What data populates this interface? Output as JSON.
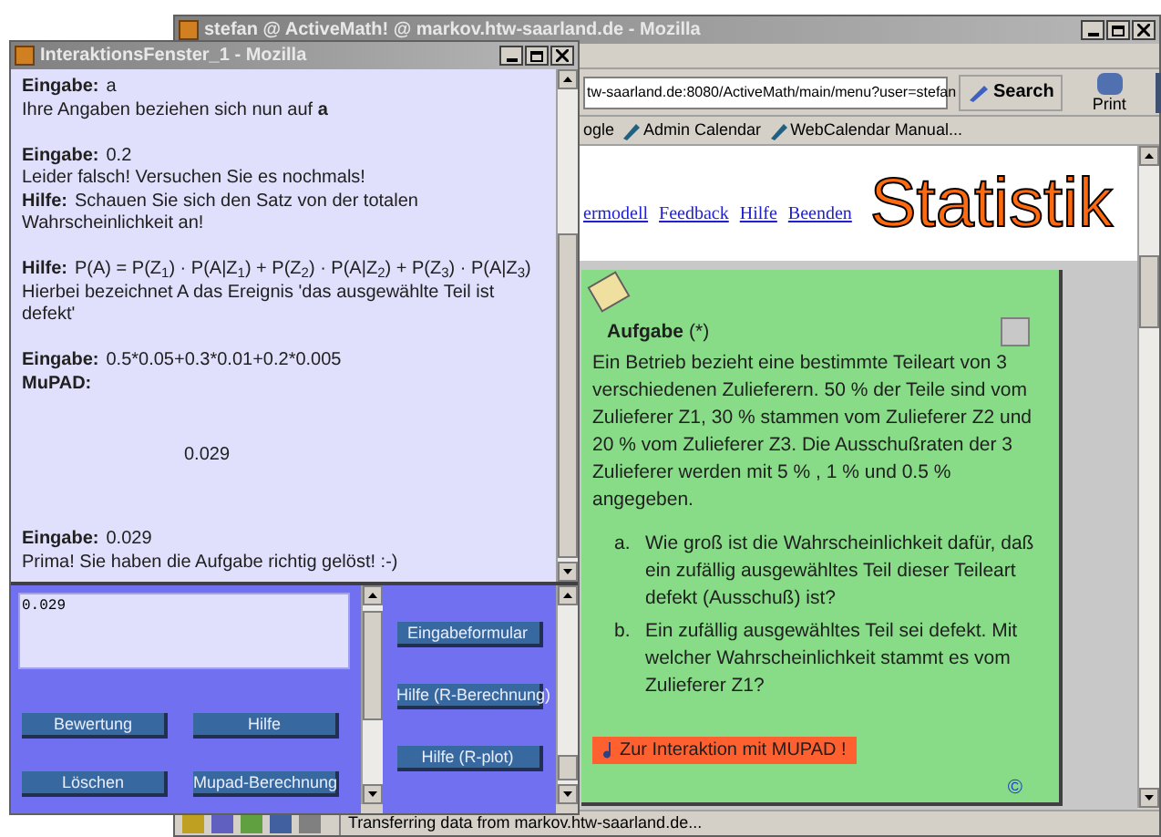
{
  "main_window": {
    "title": "stefan @ ActiveMath! @ markov.htw-saarland.de - Mozilla",
    "url": "tw-saarland.de:8080/ActiveMath/main/menu?user=stefan",
    "search_button": "Search",
    "print_button": "Print",
    "bookmarks": [
      "ogle",
      "Admin Calendar",
      "WebCalendar Manual..."
    ],
    "nav_links": [
      "ermodell",
      "Feedback",
      "Hilfe",
      "Beenden"
    ],
    "logo": "Statistik",
    "exercise": {
      "title": "Aufgabe",
      "stars": "(*)",
      "text": "Ein Betrieb bezieht eine bestimmte Teileart von 3 verschiedenen Zulieferern. 50 % der Teile sind vom Zulieferer Z1, 30 % stammen vom Zulieferer Z2 und 20 % vom Zulieferer Z3. Die Ausschußraten der 3 Zulieferer werden mit 5 % , 1 % und 0.5 % angegeben.",
      "questions": [
        {
          "marker": "a.",
          "text": "Wie groß ist die Wahrscheinlichkeit dafür, daß ein zufällig ausgewähltes Teil dieser Teileart defekt (Ausschuß) ist?"
        },
        {
          "marker": "b.",
          "text": "Ein zufällig ausgewähltes Teil sei defekt. Mit welcher Wahrscheinlichkeit stammt es vom Zulieferer Z1?"
        }
      ],
      "action_button": "Zur Interaktion mit MUPAD !",
      "copyright": "©"
    },
    "status": "Transferring data from markov.htw-saarland.de..."
  },
  "popup": {
    "title": "InteraktionsFenster_1 - Mozilla",
    "log": [
      {
        "kind": "text",
        "lines": [
          {
            "label": "Eingabe:",
            "text": "a"
          },
          {
            "text": "Ihre Angaben beziehen sich nun auf **a**"
          }
        ]
      },
      {
        "kind": "text",
        "lines": [
          {
            "label": "Eingabe:",
            "text": "0.2"
          },
          {
            "text": "Leider falsch! Versuchen Sie es nochmals!"
          },
          {
            "label": "Hilfe:",
            "text": "Schauen Sie sich den Satz von der totalen Wahrscheinlichkeit an!"
          }
        ]
      },
      {
        "kind": "text",
        "lines": [
          {
            "label": "Hilfe:",
            "text": "P(A) = P(Z$_{1}$) · P(A|Z$_{1}$) + P(Z$_{2}$) · P(A|Z$_{2}$) + P(Z$_{3}$) · P(A|Z$_{3}$)"
          },
          {
            "text": "Hierbei bezeichnet A das Ereignis 'das ausgewählte Teil ist defekt'"
          }
        ]
      },
      {
        "kind": "text",
        "lines": [
          {
            "label": "Eingabe:",
            "text": "0.5*0.05+0.3*0.01+0.2*0.005"
          },
          {
            "label": "MuPAD:"
          }
        ]
      },
      {
        "kind": "result",
        "lines": [
          {
            "text": "0.029"
          }
        ]
      },
      {
        "kind": "text",
        "lines": [
          {
            "label": "Eingabe:",
            "text": "0.029"
          },
          {
            "text": "Prima! Sie haben die Aufgabe richtig gelöst! :-)"
          }
        ]
      }
    ],
    "input": "0.029",
    "buttons": [
      "Bewertung",
      "Hilfe",
      "Löschen",
      "Mupad-Berechnung"
    ],
    "side_buttons": [
      "Eingabeformular",
      "Hilfe (R-Berechnung)",
      "Hilfe (R-plot)"
    ]
  }
}
